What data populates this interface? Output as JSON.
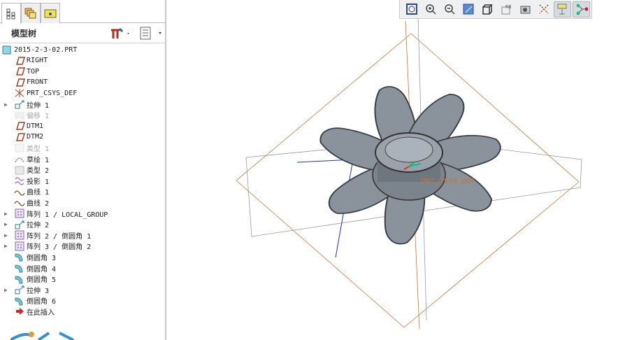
{
  "panel": {
    "title": "模型树",
    "tabs": [
      "model-tree",
      "layers",
      "folder"
    ]
  },
  "tree": [
    {
      "label": "2015-2-3-02.PRT",
      "icon": "part-icon",
      "indent": 0
    },
    {
      "label": "RIGHT",
      "icon": "datum-plane-icon",
      "indent": 1
    },
    {
      "label": "TOP",
      "icon": "datum-plane-icon",
      "indent": 1
    },
    {
      "label": "FRONT",
      "icon": "datum-plane-icon",
      "indent": 1
    },
    {
      "label": "PRT_CSYS_DEF",
      "icon": "csys-icon",
      "indent": 1
    },
    {
      "label": "拉伸 1",
      "icon": "extrude-icon",
      "indent": 1,
      "expand": true
    },
    {
      "label": "偏移 1",
      "icon": "offset-icon",
      "indent": 1,
      "dim": true
    },
    {
      "label": "DTM1",
      "icon": "datum-plane-icon",
      "indent": 1
    },
    {
      "label": "DTM2",
      "icon": "datum-plane-icon",
      "indent": 1
    },
    {
      "label": "类型 1",
      "icon": "surface-icon",
      "indent": 1,
      "dim": true
    },
    {
      "label": "草绘 1",
      "icon": "sketch-icon",
      "indent": 1
    },
    {
      "label": "类型 2",
      "icon": "surface-icon",
      "indent": 1
    },
    {
      "label": "投影 1",
      "icon": "projection-icon",
      "indent": 1
    },
    {
      "label": "曲线 1",
      "icon": "curve-icon",
      "indent": 1
    },
    {
      "label": "曲线 2",
      "icon": "curve-icon",
      "indent": 1
    },
    {
      "label": "阵列 1 / LOCAL_GROUP",
      "icon": "pattern-icon",
      "indent": 1,
      "expand": true
    },
    {
      "label": "拉伸 2",
      "icon": "extrude-icon",
      "indent": 1,
      "expand": true
    },
    {
      "label": "阵列 2 / 倒圆角 1",
      "icon": "pattern-icon",
      "indent": 1,
      "expand": true
    },
    {
      "label": "阵列 3 / 倒圆角 2",
      "icon": "pattern-icon",
      "indent": 1,
      "expand": true
    },
    {
      "label": "倒圆角 3",
      "icon": "round-icon",
      "indent": 1
    },
    {
      "label": "倒圆角 4",
      "icon": "round-icon",
      "indent": 1
    },
    {
      "label": "倒圆角 5",
      "icon": "round-icon",
      "indent": 1
    },
    {
      "label": "拉伸 3",
      "icon": "extrude-icon",
      "indent": 1,
      "expand": true
    },
    {
      "label": "倒圆角 6",
      "icon": "round-icon",
      "indent": 1
    },
    {
      "label": "在此插入",
      "icon": "insert-here-arrow-icon",
      "indent": 1
    }
  ],
  "toolbar": [
    "refit-icon",
    "zoom-in-icon",
    "zoom-out-icon",
    "repaint-icon",
    "display-style-icon",
    "saved-views-icon",
    "view-manager-icon",
    "datum-display-icon",
    "annotation-display-icon",
    "spin-center-icon"
  ],
  "viewport": {
    "csys_label": "PRT_CSYS_DEF"
  },
  "colors": {
    "datum": "#c87533",
    "model": "#6e7680"
  }
}
